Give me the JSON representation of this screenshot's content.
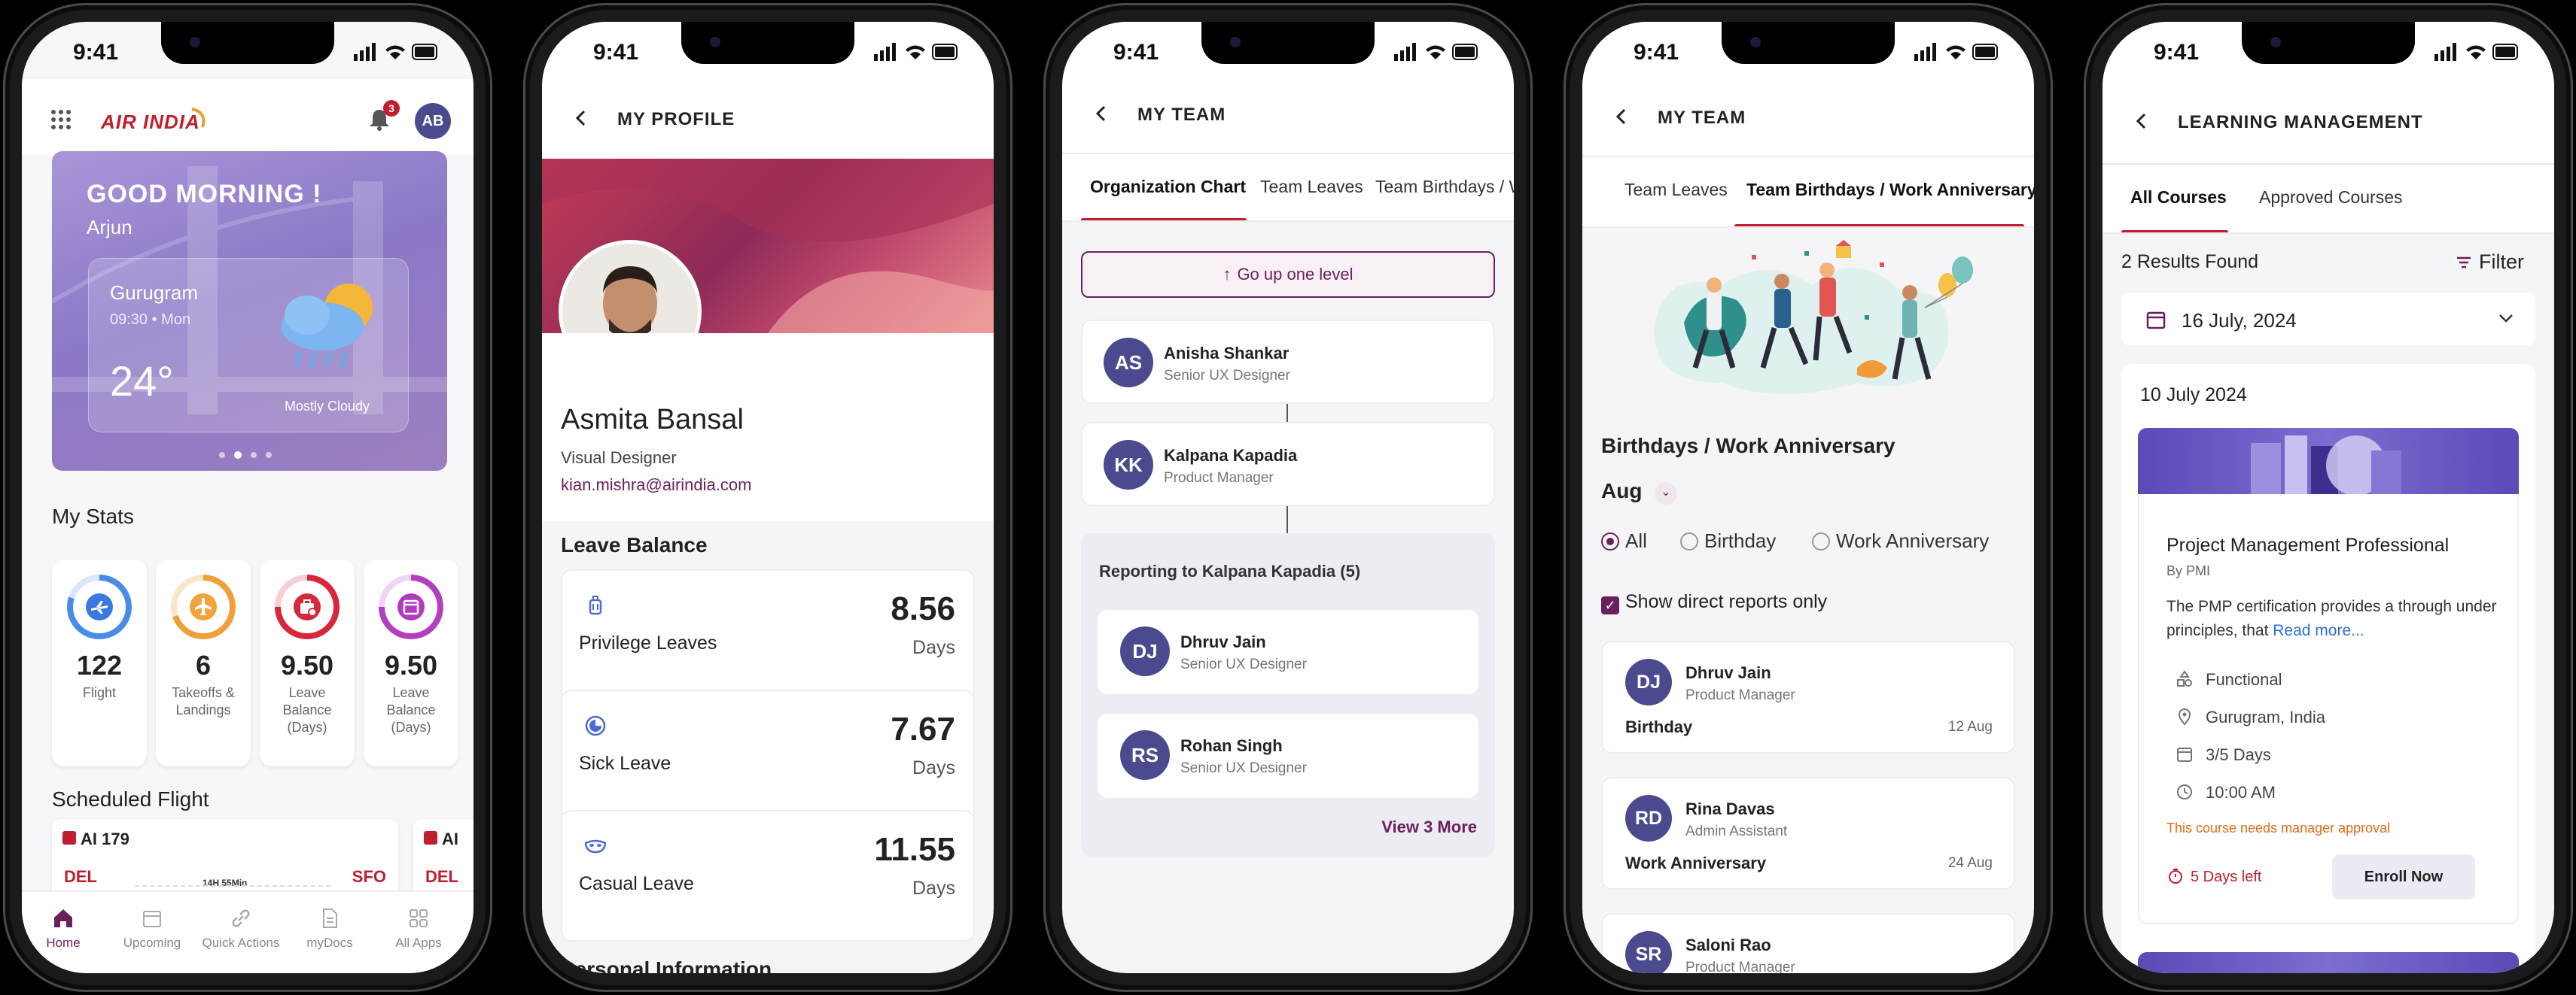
{
  "status_time": "9:41",
  "colors": {
    "brand": "#6b1f5c",
    "accent_red": "#c01e2e",
    "avatar": "#4b4a8e"
  },
  "home": {
    "logo_text": "AIR INDIA",
    "notif_count": "3",
    "user_initials": "AB",
    "greeting": "GOOD MORNING !",
    "user_name": "Arjun",
    "weather": {
      "city": "Gurugram",
      "time": "09:30 • Mon",
      "temp": "24°",
      "condition": "Mostly Cloudy"
    },
    "stats_title": "My Stats",
    "stats": [
      {
        "value": "122",
        "label": "Flight",
        "icon": "plane-icon"
      },
      {
        "value": "6",
        "label": "Takeoffs & Landings",
        "icon": "takeoff-icon"
      },
      {
        "value": "9.50",
        "label": "Leave Balance (Days)",
        "icon": "briefcase-icon"
      },
      {
        "value": "9.50",
        "label": "Leave Balance (Days)",
        "icon": "calendar-icon"
      }
    ],
    "scheduled_title": "Scheduled Flight",
    "flight": {
      "number": "AI 179",
      "from": "DEL",
      "to": "SFO",
      "duration": "14H 55Min",
      "next_number": "AI",
      "next_from": "DEL"
    },
    "nav": [
      "Home",
      "Upcoming",
      "Quick Actions",
      "myDocs",
      "All Apps"
    ]
  },
  "profile": {
    "title": "MY PROFILE",
    "name": "Asmita Bansal",
    "role": "Visual Designer",
    "email": "kian.mishra@airindia.com",
    "leave_title": "Leave Balance",
    "leaves": [
      {
        "name": "Privilege Leaves",
        "value": "8.56",
        "unit": "Days",
        "icon": "luggage-icon"
      },
      {
        "name": "Sick Leave",
        "value": "7.67",
        "unit": "Days",
        "icon": "moon-icon"
      },
      {
        "name": "Casual Leave",
        "value": "11.55",
        "unit": "Days",
        "icon": "mask-icon"
      }
    ],
    "next_section": "Personal Information"
  },
  "team": {
    "title": "MY TEAM",
    "tabs": [
      "Organization Chart",
      "Team Leaves",
      "Team Birthdays / W"
    ],
    "go_up": "Go up one level",
    "chain": [
      {
        "initials": "AS",
        "name": "Anisha Shankar",
        "role": "Senior UX Designer"
      },
      {
        "initials": "KK",
        "name": "Kalpana Kapadia",
        "role": "Product Manager"
      }
    ],
    "reporting_title": "Reporting to Kalpana Kapadia (5)",
    "reports": [
      {
        "initials": "DJ",
        "name": "Dhruv Jain",
        "role": "Senior UX Designer"
      },
      {
        "initials": "RS",
        "name": "Rohan Singh",
        "role": "Senior UX Designer"
      }
    ],
    "view_more": "View 3 More"
  },
  "birthdays": {
    "title": "MY TEAM",
    "tabs": [
      "Team Leaves",
      "Team Birthdays / Work Anniversary"
    ],
    "section_title": "Birthdays / Work Anniversary",
    "month": "Aug",
    "filters": [
      "All",
      "Birthday",
      "Work Anniversary"
    ],
    "checkbox": "Show direct reports only",
    "items": [
      {
        "initials": "DJ",
        "name": "Dhruv Jain",
        "role": "Product Manager",
        "kind": "Birthday",
        "date": "12 Aug"
      },
      {
        "initials": "RD",
        "name": "Rina Davas",
        "role": "Admin Assistant",
        "kind": "Work Anniversary",
        "date": "24 Aug"
      },
      {
        "initials": "SR",
        "name": "Saloni Rao",
        "role": "Product Manager",
        "kind": "",
        "date": ""
      }
    ]
  },
  "learning": {
    "title": "LEARNING MANAGEMENT",
    "tabs": [
      "All Courses",
      "Approved Courses"
    ],
    "results": "2 Results Found",
    "filter": "Filter",
    "date_select": "16 July, 2024",
    "group_date": "10 July 2024",
    "course": {
      "title": "Project Management Professional",
      "by": "By PMI",
      "desc": "The PMP certification provides a through under principles, that",
      "read_more": "Read more...",
      "meta": [
        {
          "icon": "shapes-icon",
          "text": "Functional"
        },
        {
          "icon": "location-icon",
          "text": "Gurugram, India"
        },
        {
          "icon": "calendar-icon",
          "text": "3/5 Days"
        },
        {
          "icon": "clock-icon",
          "text": "10:00 AM"
        }
      ],
      "approval": "This course needs manager approval",
      "days_left": "5 Days left",
      "enroll": "Enroll Now"
    }
  }
}
